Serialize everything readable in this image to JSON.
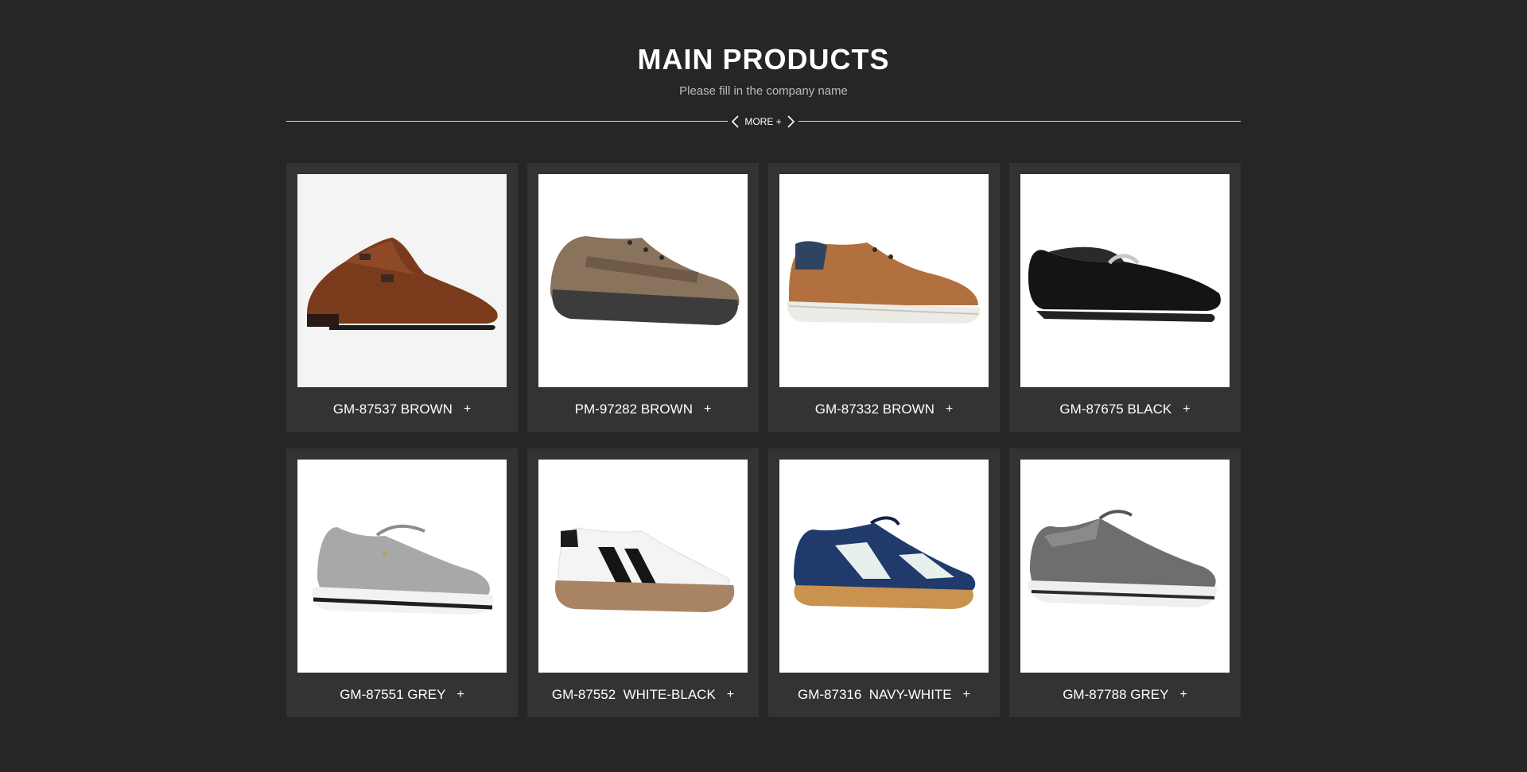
{
  "header": {
    "title": "MAIN PRODUCTS",
    "subtitle": "Please fill in the company name",
    "more_label": "MORE +"
  },
  "products": [
    {
      "name": "GM-87537 BROWN",
      "plus": "+",
      "image": "brown-monk-strap-shoe"
    },
    {
      "name": "PM-97282 BROWN",
      "plus": "+",
      "image": "brown-casual-sneaker"
    },
    {
      "name": "GM-87332 BROWN",
      "plus": "+",
      "image": "brown-suede-derby-shoe"
    },
    {
      "name": "GM-87675 BLACK",
      "plus": "+",
      "image": "black-loafer"
    },
    {
      "name": "GM-87551 GREY",
      "plus": "+",
      "image": "grey-knit-sneaker"
    },
    {
      "name": "GM-87552  WHITE-BLACK",
      "plus": "+",
      "image": "white-black-stripe-sneaker"
    },
    {
      "name": "GM-87316  NAVY-WHITE",
      "plus": "+",
      "image": "navy-white-sneaker"
    },
    {
      "name": "GM-87788 GREY",
      "plus": "+",
      "image": "grey-running-shoe"
    }
  ]
}
